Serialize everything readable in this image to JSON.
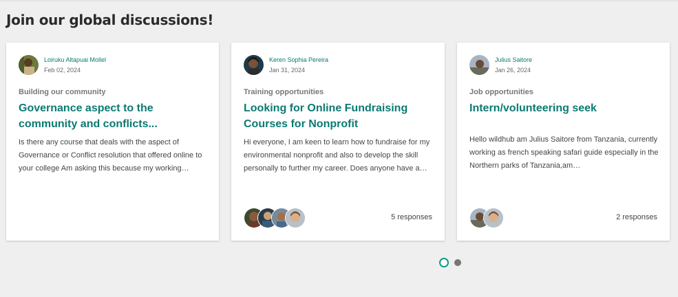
{
  "section": {
    "title": "Join our global discussions!"
  },
  "cards": [
    {
      "author": "Loiruku Altapuai Mollel",
      "date": "Feb 02, 2024",
      "category": "Building our community",
      "title": "Governance aspect to the community and conflicts...",
      "excerpt": "Is there any course that deals with the aspect of Governance or Conflict resolution that offered online to your college Am asking this because my working…",
      "responses": ""
    },
    {
      "author": "Keren Sophia Pereira",
      "date": "Jan 31, 2024",
      "category": "Training opportunities",
      "title": "Looking for Online Fundraising Courses for Nonprofit",
      "excerpt": "Hi everyone, I am keen to learn how to fundraise for my environmental nonprofit and also to develop the skill personally to further my career. Does anyone have a…",
      "responses": "5 responses"
    },
    {
      "author": "Julius Saitore",
      "date": "Jan 26, 2024",
      "category": "Job opportunities",
      "title": "Intern/volunteering seek",
      "excerpt": "Hello wildhub am Julius Saitore from Tanzania, currently working as french speaking safari guide especially in the Northern parks of Tanzania,am…",
      "responses": "2 responses"
    }
  ],
  "carousel": {
    "pages": 2,
    "active": 1
  },
  "colors": {
    "accent": "#0a7a73",
    "dot_active": "#0a9a90",
    "dot": "#777777",
    "background": "#efefef"
  }
}
